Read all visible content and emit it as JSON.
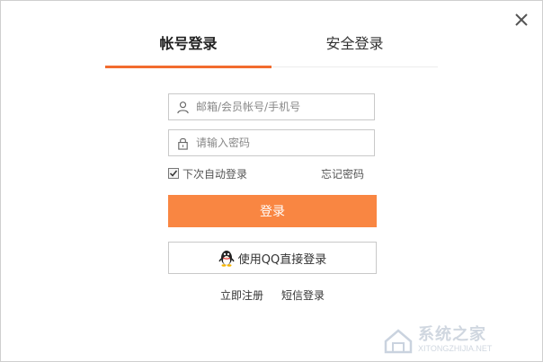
{
  "tabs": [
    {
      "label": "帐号登录",
      "active": true
    },
    {
      "label": "安全登录",
      "active": false
    }
  ],
  "username_field": {
    "placeholder": "邮箱/会员帐号/手机号",
    "value": "",
    "icon": "user-icon"
  },
  "password_field": {
    "placeholder": "请输入密码",
    "value": "",
    "icon": "lock-icon"
  },
  "remember_me": {
    "label": "下次自动登录",
    "checked": true
  },
  "forgot_password_label": "忘记密码",
  "login_button_label": "登录",
  "qq_login_label": "使用QQ直接登录",
  "footer_links": {
    "register": "立即注册",
    "sms_login": "短信登录"
  },
  "watermark": {
    "text": "系统之家",
    "sub": "XITONGZHIJIA.NET"
  },
  "colors": {
    "accent": "#f26c2e",
    "login_button": "#f98642"
  }
}
